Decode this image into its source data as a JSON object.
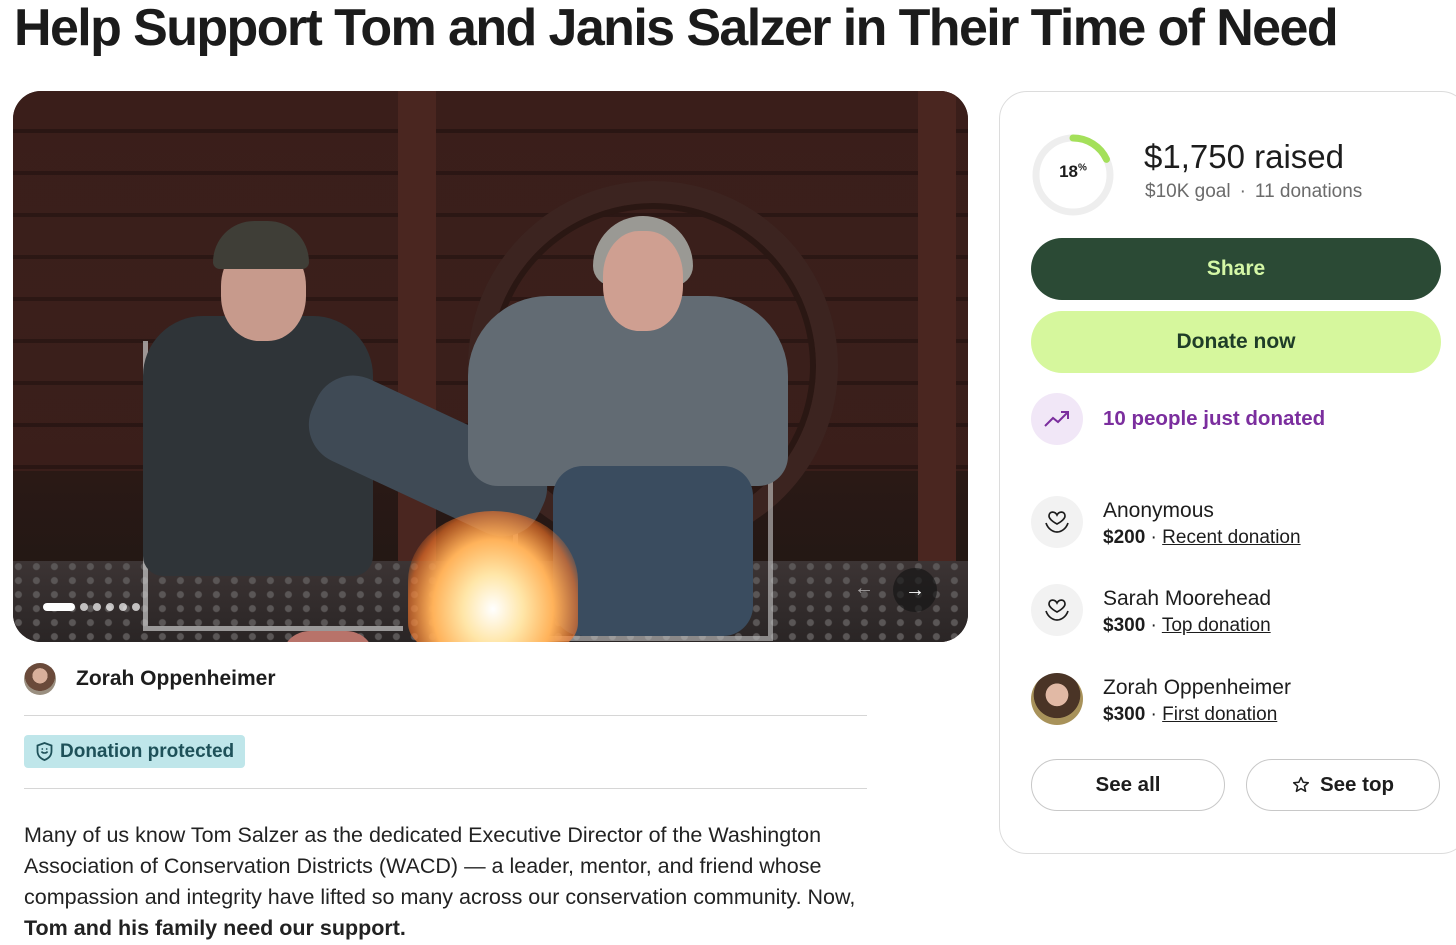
{
  "page": {
    "title": "Help Support Tom and Janis Salzer in Their Time of Need"
  },
  "gallery": {
    "slide_count": 6,
    "active_slide": 1,
    "prev_icon": "arrow-left-icon",
    "next_icon": "arrow-right-icon"
  },
  "organizer": {
    "name": "Zorah Oppenheimer"
  },
  "badge": {
    "label": "Donation protected",
    "icon": "shield-icon"
  },
  "story": {
    "text": "Many of us know Tom Salzer as the dedicated Executive Director of the Washington Association of Conservation Districts (WACD) — a leader, mentor, and friend whose compassion and integrity have lifted so many across our conservation community. Now,",
    "bold": "Tom and his family need our support."
  },
  "progress": {
    "percent_label": "18",
    "percent_symbol": "%",
    "fraction": 0.18,
    "raised": "$1,750 raised",
    "goal": "$10K goal",
    "donations": "11 donations"
  },
  "actions": {
    "share_label": "Share",
    "donate_label": "Donate now"
  },
  "activity": {
    "label": "10 people just donated",
    "icon": "trending-up-icon"
  },
  "donations": [
    {
      "name": "Anonymous",
      "amount": "$200",
      "separator": " · ",
      "tag": "Recent donation",
      "icon": "heart-hand-icon"
    },
    {
      "name": "Sarah Moorehead",
      "amount": "$300",
      "separator": " · ",
      "tag": "Top donation",
      "icon": "heart-hand-icon"
    },
    {
      "name": "Zorah Oppenheimer",
      "amount": "$300",
      "separator": " · ",
      "tag": "First donation",
      "icon": "avatar-photo"
    }
  ],
  "footer_buttons": {
    "see_all": "See all",
    "see_top": "See top",
    "see_top_icon": "star-icon"
  },
  "colors": {
    "share_bg": "#2b4a35",
    "share_text": "#d4f7a6",
    "donate_bg": "#d6f79d",
    "progress_green": "#a4e05a",
    "activity_purple": "#7b2e9e",
    "badge_bg": "#bfe6ea"
  }
}
